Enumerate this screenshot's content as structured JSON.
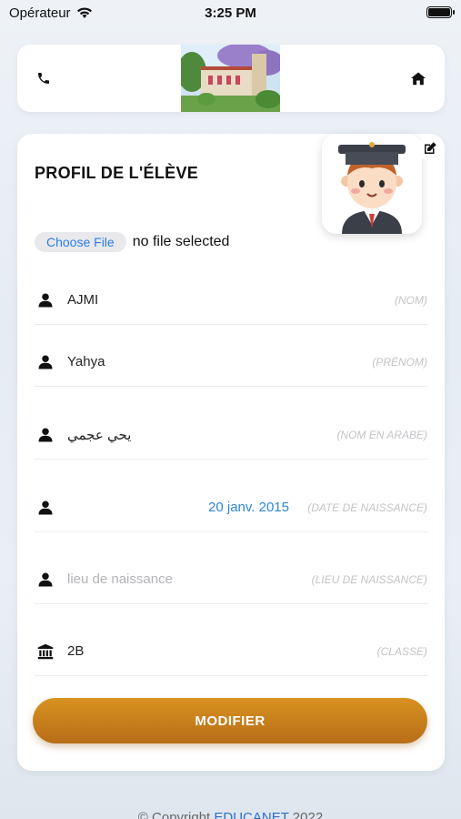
{
  "status_bar": {
    "carrier": "Opérateur",
    "time": "3:25 PM"
  },
  "header": {
    "phone_icon": "phone-icon",
    "home_icon": "home-icon"
  },
  "profile": {
    "title": "PROFIL DE L'ÉLÈVE",
    "choose_file_label": "Choose File",
    "file_status": "no file selected",
    "submit_label": "MODIFIER"
  },
  "fields": [
    {
      "icon": "user-icon",
      "value": "AJMI",
      "label": "(NOM)"
    },
    {
      "icon": "user-icon",
      "value": "Yahya",
      "label": "(PRÉNOM)"
    },
    {
      "icon": "user-icon",
      "value": "يحي عجمي",
      "label": "(NOM EN ARABE)"
    },
    {
      "icon": "user-icon",
      "value": "20 janv. 2015",
      "label": "(DATE DE NAISSANCE)"
    },
    {
      "icon": "user-icon",
      "placeholder": "lieu de naissance",
      "label": "(LIEU DE NAISSANCE)"
    },
    {
      "icon": "institution-icon",
      "value": "2B",
      "label": "(CLASSE)"
    }
  ],
  "footer": {
    "prefix": "© Copyright ",
    "brand": "EDUCANET",
    "year": " 2022"
  },
  "colors": {
    "accent_orange": "#c98019",
    "date_blue": "#2f86d8",
    "brand_blue": "#2b6fc7"
  }
}
